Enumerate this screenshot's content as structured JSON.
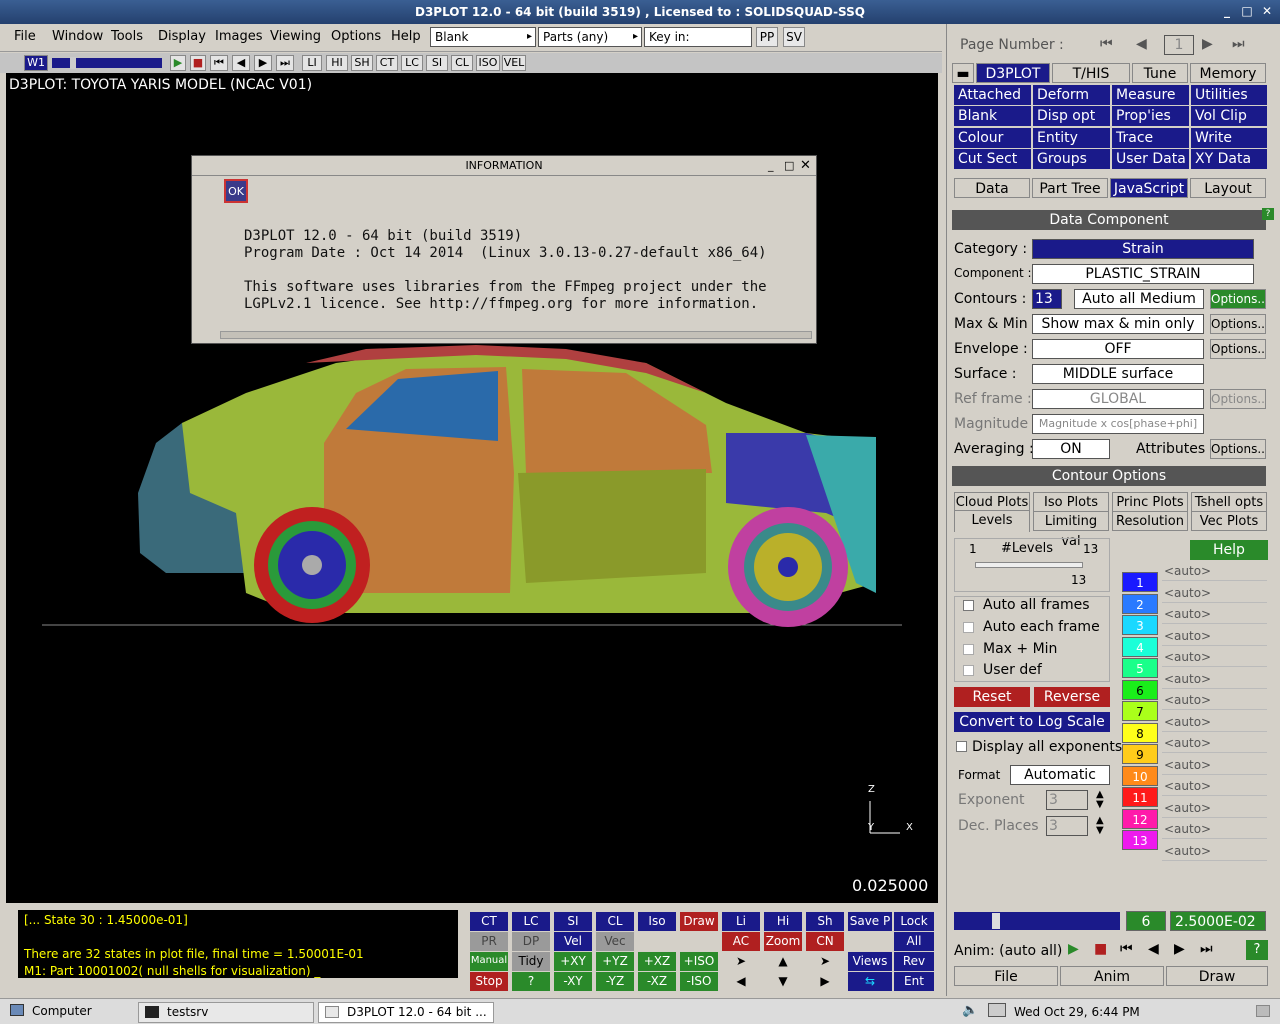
{
  "window": {
    "title": "D3PLOT 12.0 - 64 bit (build 3519) , Licensed to : SOLIDSQUAD-SSQ"
  },
  "menubar": {
    "items": [
      "File",
      "Window",
      "Tools",
      "Display",
      "Images",
      "Viewing",
      "Options",
      "Help"
    ],
    "combo1": "Blank",
    "combo2": "Parts (any)",
    "key_in": "Key in:",
    "pp": "PP",
    "sv": "SV"
  },
  "toolbar2": {
    "window_label": "W1",
    "buttons": [
      "LI",
      "HI",
      "SH",
      "CT",
      "LC",
      "SI",
      "CL",
      "ISO",
      "VEL"
    ]
  },
  "viewport": {
    "title": "D3PLOT: TOYOTA YARIS MODEL (NCAC V01)",
    "time": "0.025000",
    "axis_z": "Z",
    "axis_x": "X",
    "axis_y": "Y"
  },
  "dialog": {
    "title": "INFORMATION",
    "ok": "OK",
    "lines": [
      "D3PLOT 12.0 - 64 bit (build 3519)",
      "Program Date : Oct 14 2014  (Linux 3.0.13-0.27-default x86_64)",
      "",
      "This software uses libraries from the FFmpeg project under the",
      "LGPLv2.1 licence. See http://ffmpeg.org for more information."
    ]
  },
  "console": {
    "lines": [
      "[... State 30 :   1.45000e-01]",
      "",
      "There are     32 states in plot file, final time = 1.50001E-01",
      "M1: Part 10001002( null shells for visualization) _"
    ]
  },
  "controls": {
    "row1": [
      "CT",
      "LC",
      "SI",
      "CL",
      "Iso",
      "Draw",
      "Li",
      "Hi",
      "Sh",
      "Save P",
      "Lock"
    ],
    "row2": [
      "PR",
      "DP",
      "Vel",
      "Vec",
      "AC",
      "Zoom",
      "CN",
      "All"
    ],
    "row3": [
      "Manual",
      "Tidy",
      "+XY",
      "+YZ",
      "+XZ",
      "+ISO",
      "Views",
      "Rev"
    ],
    "row4": [
      "Stop",
      "?",
      "-XY",
      "-YZ",
      "-XZ",
      "-ISO",
      "Ent"
    ]
  },
  "right_panel": {
    "page_number_label": "Page Number :",
    "page_number": "1",
    "main_tabs": [
      "D3PLOT",
      "T/HIS",
      "Tune",
      "Memory"
    ],
    "function_buttons": [
      "Attached",
      "Deform",
      "Measure",
      "Utilities",
      "Blank",
      "Disp opt",
      "Prop'ies",
      "Vol Clip",
      "Colour",
      "Entity",
      "Trace",
      "Write",
      "Cut Sect",
      "Groups",
      "User Data",
      "XY Data"
    ],
    "sub_tabs": [
      "Data",
      "Part Tree",
      "JavaScript",
      "Layout"
    ],
    "data_component_header": "Data Component",
    "category_label": "Category :",
    "category": "Strain",
    "component_label": "Component :",
    "component": "PLASTIC_STRAIN",
    "contours_label": "Contours :",
    "contours": "13",
    "contours_mode": "Auto all Medium",
    "options": "Options..",
    "maxmin_label": "Max & Min :",
    "maxmin": "Show max & min only",
    "envelope_label": "Envelope :",
    "envelope": "OFF",
    "surface_label": "Surface :",
    "surface": "MIDDLE surface",
    "refframe_label": "Ref frame :",
    "refframe": "GLOBAL",
    "magnitude_label": "Magnitude :",
    "magnitude": "Magnitude x cos[phase+phi]",
    "averaging_label": "Averaging :",
    "averaging": "ON",
    "attributes_label": "Attributes :",
    "contour_options_header": "Contour Options",
    "contour_tabs": [
      "Cloud Plots",
      "Iso Plots",
      "Princ Plots",
      "Tshell opts",
      "Levels",
      "Limiting val",
      "Resolution",
      "Vec Plots"
    ],
    "levels_min": "1",
    "levels_label": "#Levels",
    "levels_max": "13",
    "levels_value": "13",
    "help": "Help",
    "auto_all_frames": "Auto all frames",
    "auto_each_frame": "Auto each frame",
    "max_min": "Max + Min",
    "user_def": "User def",
    "reset": "Reset",
    "reverse": "Reverse",
    "convert_log": "Convert to Log Scale",
    "display_exponents": "Display all exponents",
    "format_label": "Format",
    "format": "Automatic",
    "exponent_label": "Exponent",
    "exponent": "3",
    "dec_places_label": "Dec. Places",
    "dec_places": "3",
    "level_numbers": [
      "1",
      "2",
      "3",
      "4",
      "5",
      "6",
      "7",
      "8",
      "9",
      "10",
      "11",
      "12",
      "13"
    ],
    "level_colors": [
      "#1a1aff",
      "#2a7aff",
      "#1ad8ff",
      "#1affd8",
      "#1aff8a",
      "#1aee1a",
      "#aaff1a",
      "#ffff1a",
      "#ffcc1a",
      "#ff8a1a",
      "#ff1a1a",
      "#ff1aaa",
      "#ee1aee"
    ],
    "auto_value": "<auto>",
    "state_number": "6",
    "state_time": "2.5000E-02",
    "anim_label": "Anim: (auto all)",
    "bottom_tabs": [
      "File",
      "Anim",
      "Draw"
    ]
  },
  "taskbar": {
    "computer": "Computer",
    "task1": "testsrv",
    "task2": "D3PLOT 12.0 - 64 bit ...",
    "clock": "Wed Oct 29,  6:44 PM"
  }
}
